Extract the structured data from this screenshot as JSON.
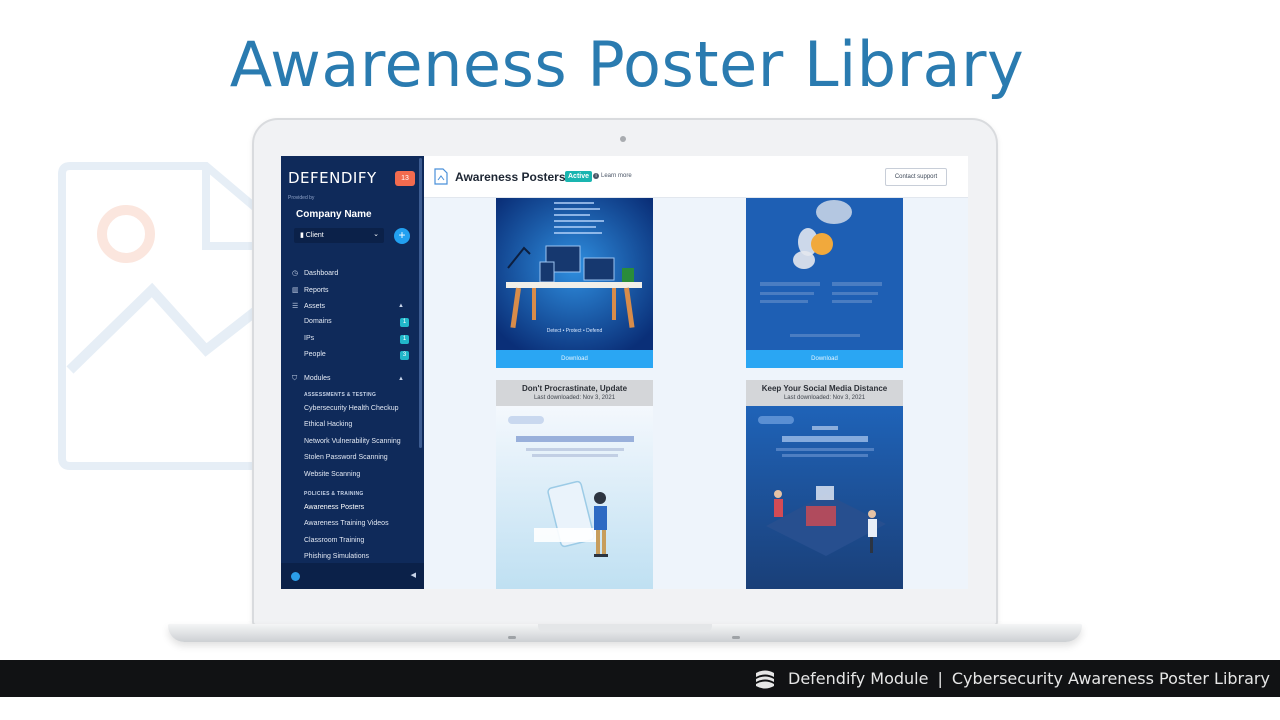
{
  "headline": "Awareness Poster Library",
  "sidebar": {
    "logo_text": "DEFENDIFY",
    "notification_count": "13",
    "provided_by": "Provided by",
    "company_name": "Company Name",
    "client_select": "Client",
    "nav": {
      "dashboard": "Dashboard",
      "reports": "Reports",
      "assets": "Assets",
      "domains": "Domains",
      "domains_count": "1",
      "ips": "IPs",
      "ips_count": "1",
      "people": "People",
      "people_count": "3",
      "modules": "Modules",
      "assessments_heading": "ASSESSMENTS & TESTING",
      "health_checkup": "Cybersecurity Health Checkup",
      "ethical_hacking": "Ethical Hacking",
      "network_scanning": "Network Vulnerability Scanning",
      "password_scanning": "Stolen Password Scanning",
      "website_scanning": "Website Scanning",
      "policies_heading": "POLICIES & TRAINING",
      "awareness_posters": "Awareness Posters",
      "training_videos": "Awareness Training Videos",
      "classroom_training": "Classroom Training",
      "phishing": "Phishing Simulations"
    }
  },
  "topbar": {
    "title": "Awareness Posters",
    "status_badge": "Active",
    "learn_more": "Learn more",
    "contact_support": "Contact support"
  },
  "posters": [
    {
      "caption": "Detect • Protect • Defend",
      "download_label": "Download"
    },
    {
      "download_label": "Download"
    },
    {
      "title": "Don't Procrastinate, Update",
      "last_downloaded": "Last downloaded: Nov 3, 2021"
    },
    {
      "title": "Keep Your Social Media Distance",
      "last_downloaded": "Last downloaded: Nov 3, 2021"
    }
  ],
  "footer": {
    "module": "Defendify Module",
    "separator": "|",
    "description": "Cybersecurity Awareness Poster Library"
  },
  "colors": {
    "headline": "#2a7bb0",
    "sidebar": "#0f2a5a",
    "accent": "#2aa6f3",
    "active_badge": "#1ab5b0"
  }
}
